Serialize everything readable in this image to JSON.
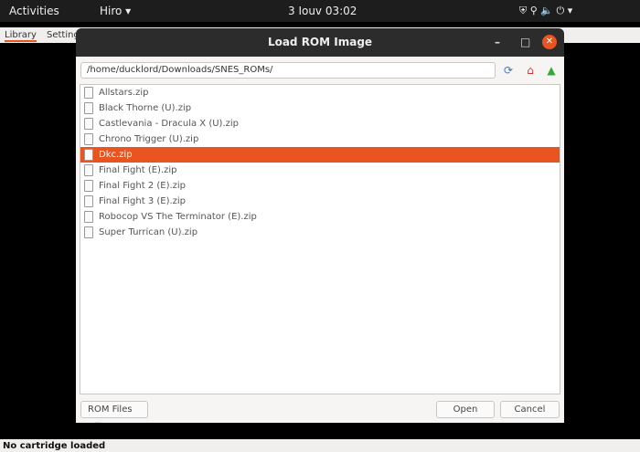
{
  "topbar": {
    "activities": "Activities",
    "app": "Hiro ▾",
    "clock": "3 Iouv  03:02",
    "tray": "⛨   ⚲ 🔈 ⏻ ▾"
  },
  "app": {
    "tabs": [
      "Library",
      "Settings"
    ],
    "status": "No cartridge loaded"
  },
  "dialog": {
    "title": "Load ROM Image",
    "path": "/home/ducklord/Downloads/SNES_ROMs/",
    "files": [
      "Allstars.zip",
      "Black Thorne (U).zip",
      "Castlevania - Dracula X (U).zip",
      "Chrono Trigger (U).zip",
      "Dkc.zip",
      "Final Fight (E).zip",
      "Final Fight 2 (E).zip",
      "Final Fight 3 (E).zip",
      "Robocop VS The Terminator (E).zip",
      "Super Turrican (U).zip"
    ],
    "selected_index": 4,
    "filter": "ROM Files",
    "open": "Open",
    "cancel": "Cancel"
  },
  "colors": {
    "accent": "#e95420"
  }
}
